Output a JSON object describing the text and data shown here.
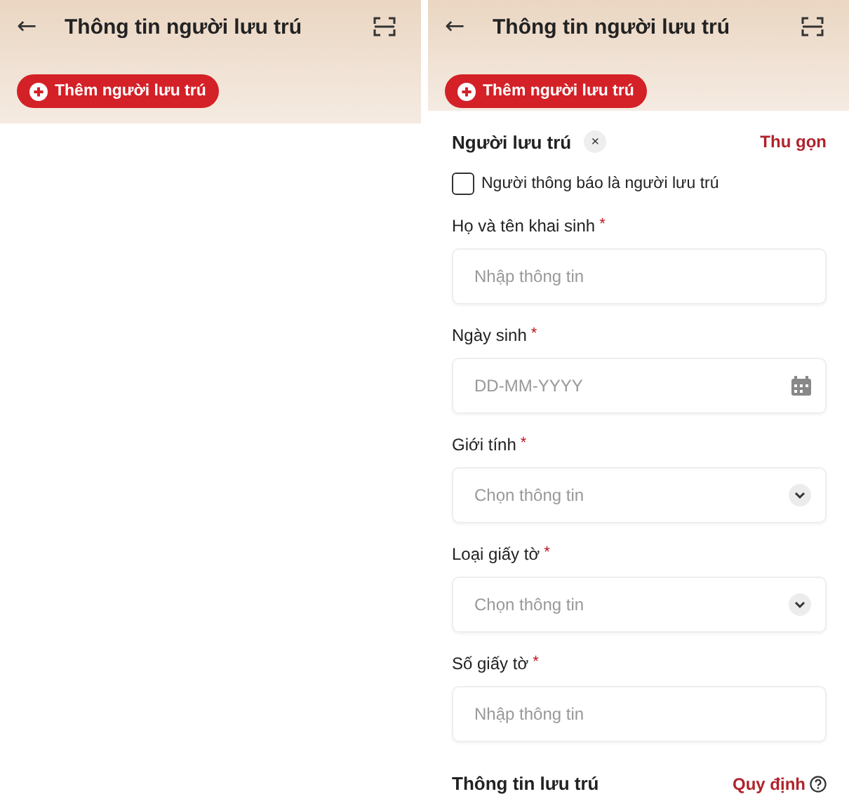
{
  "screens": [
    {
      "header": {
        "back": "←",
        "title": "Thông tin người lưu trú"
      },
      "add_button": "Thêm người lưu trú"
    },
    {
      "header": {
        "back": "←",
        "title": "Thông tin người lưu trú"
      },
      "add_button": "Thêm người lưu trú",
      "form": {
        "title": "Người lưu trú",
        "remove": "×",
        "collapse": "Thu gọn",
        "checkbox": {
          "label": "Người thông báo là người lưu trú",
          "checked": false
        },
        "fields": [
          {
            "label": "Họ và tên khai sinh",
            "required_mark": "*",
            "kind": "text",
            "placeholder": "Nhập thông tin"
          },
          {
            "label": "Ngày sinh",
            "required_mark": "*",
            "kind": "date",
            "placeholder": "DD-MM-YYYY"
          },
          {
            "label": "Giới tính",
            "required_mark": "*",
            "kind": "select",
            "placeholder": "Chọn thông tin"
          },
          {
            "label": "Loại giấy tờ",
            "required_mark": "*",
            "kind": "select",
            "placeholder": "Chọn thông tin"
          },
          {
            "label": "Số giấy tờ",
            "required_mark": "*",
            "kind": "text",
            "placeholder": "Nhập thông tin"
          }
        ],
        "section": {
          "title": "Thông tin lưu trú",
          "link": "Quy định"
        }
      }
    }
  ]
}
